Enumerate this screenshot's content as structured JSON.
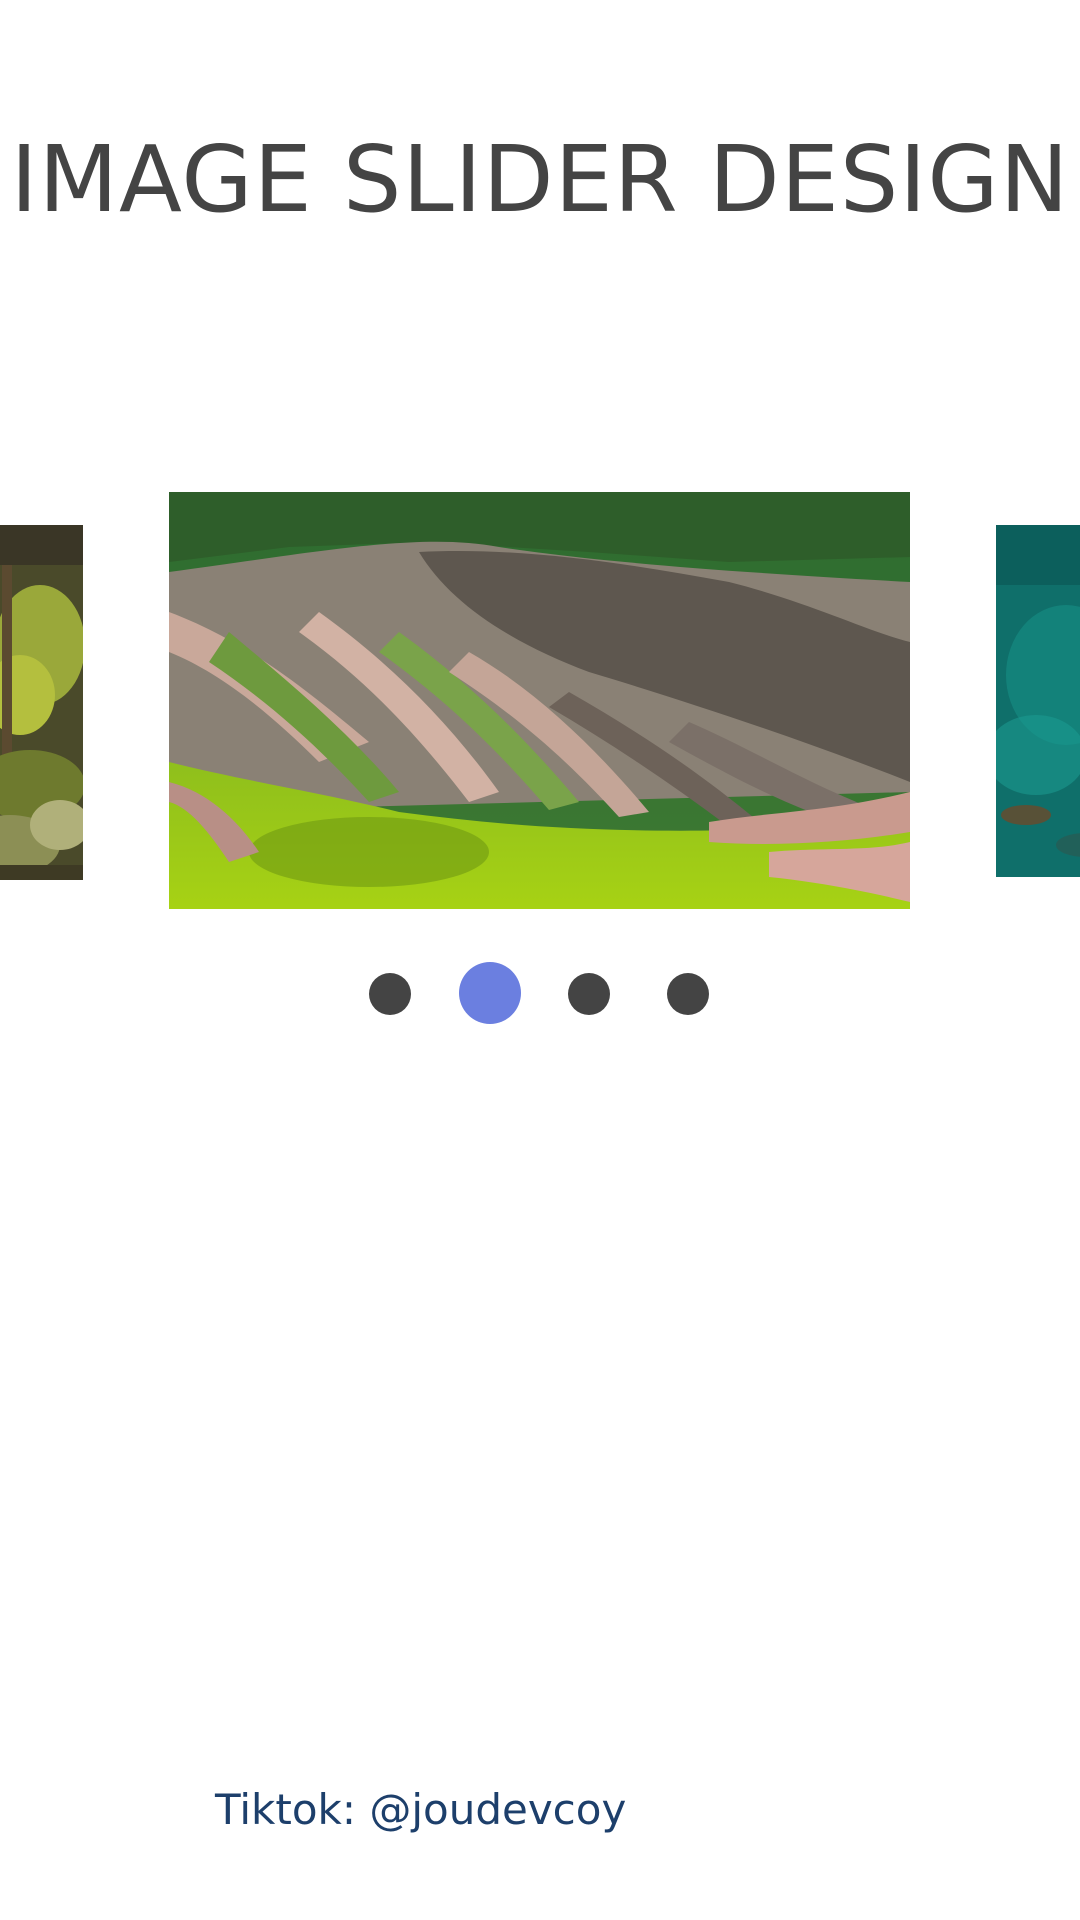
{
  "header": {
    "title": "IMAGE SLIDER DESIGN"
  },
  "slider": {
    "slides": [
      {
        "name": "forest",
        "state": "previous"
      },
      {
        "name": "eroded-valley",
        "state": "active"
      },
      {
        "name": "teal-water",
        "state": "next"
      }
    ],
    "dots": {
      "count": 4,
      "active_index": 1
    }
  },
  "footer": {
    "credit": "Tiktok: @joudevcoy"
  },
  "colors": {
    "title": "#444444",
    "dot_inactive": "#444444",
    "dot_active": "#6b7fe0",
    "credit": "#1d3f6b"
  }
}
